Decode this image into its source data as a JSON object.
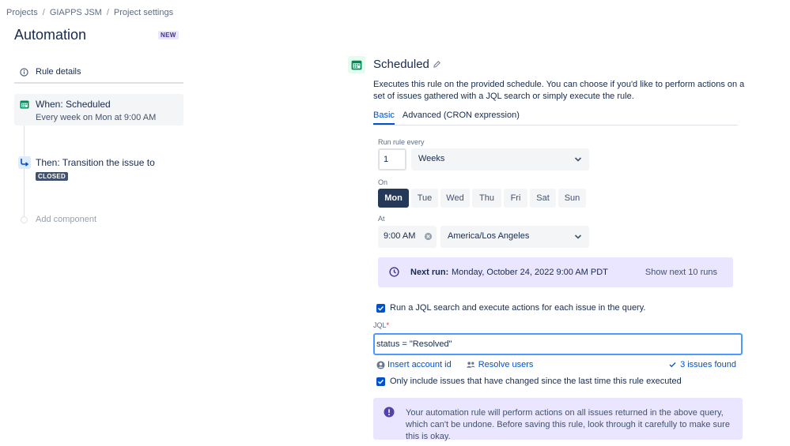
{
  "breadcrumb": {
    "items": [
      "Projects",
      "GIAPPS JSM",
      "Project settings"
    ],
    "separator": "/"
  },
  "page": {
    "title": "Automation",
    "badge": "NEW"
  },
  "sidebar": {
    "rule_details": "Rule details",
    "trigger": {
      "title": "When: Scheduled",
      "subtitle": "Every week on Mon at 9:00 AM"
    },
    "action": {
      "title": "Then: Transition the issue to",
      "status": "CLOSED"
    },
    "add_component": "Add component"
  },
  "schedule": {
    "title": "Scheduled",
    "description": "Executes this rule on the provided schedule. You can choose if you'd like to perform actions on a set of issues gathered with a JQL search or simply execute the rule.",
    "tabs": [
      {
        "label": "Basic",
        "active": true
      },
      {
        "label": "Advanced (CRON expression)",
        "active": false
      }
    ],
    "run_every_label": "Run rule every",
    "run_every_value": "1",
    "period": "Weeks",
    "on_label": "On",
    "days": [
      {
        "label": "Mon",
        "active": true
      },
      {
        "label": "Tue",
        "active": false
      },
      {
        "label": "Wed",
        "active": false
      },
      {
        "label": "Thu",
        "active": false
      },
      {
        "label": "Fri",
        "active": false
      },
      {
        "label": "Sat",
        "active": false
      },
      {
        "label": "Sun",
        "active": false
      }
    ],
    "at_label": "At",
    "time": "9:00 AM",
    "timezone": "America/Los Angeles",
    "next_run_label": "Next run:",
    "next_run_value": "Monday, October 24, 2022 9:00 AM PDT",
    "show_next": "Show next 10 runs"
  },
  "jql": {
    "run_search_label": "Run a JQL search and execute actions for each issue in the query.",
    "label": "JQL",
    "required_mark": "*",
    "value": "status = \"Resolved\"",
    "insert_account": "Insert account id",
    "resolve_users": "Resolve users",
    "issues_found": "3 issues found",
    "only_changed_label": "Only include issues that have changed since the last time this rule executed"
  },
  "warning": {
    "text": "Your automation rule will perform actions on all issues returned in the above query, which can't be undone. Before saving this rule, look through it carefully to make sure this is okay."
  },
  "colors": {
    "primary": "#0052cc",
    "dark": "#253858",
    "purple_bg": "#eae6ff",
    "warning_icon": "#5243aa",
    "green_icon": "#00875a"
  }
}
